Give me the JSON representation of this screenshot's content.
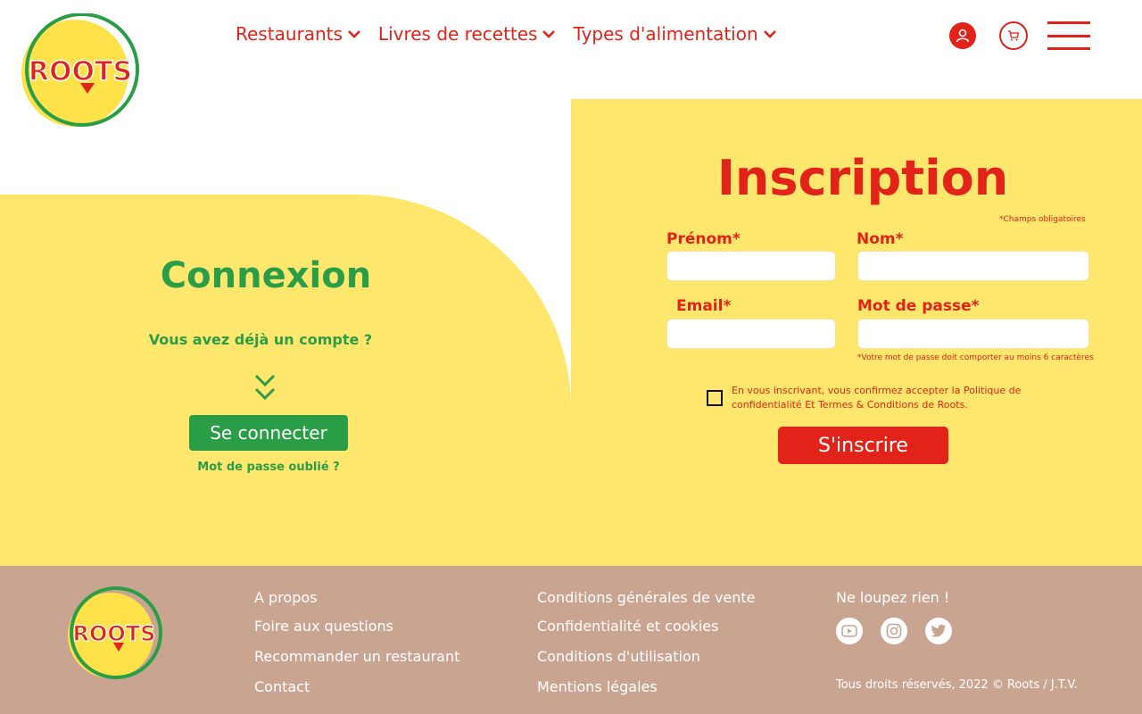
{
  "brand": {
    "name": "ROOTS",
    "colors": {
      "red": "#e2231a",
      "yellow": "#ffe66d",
      "green": "#2a9d47",
      "footer": "#c9a591"
    }
  },
  "header": {
    "nav": [
      {
        "label": "Restaurants",
        "icon": "chevron-down-icon"
      },
      {
        "label": "Livres de recettes",
        "icon": "chevron-down-icon"
      },
      {
        "label": "Types d'alimentation",
        "icon": "chevron-down-icon"
      }
    ],
    "icons": [
      "user-icon",
      "cart-icon",
      "menu-icon"
    ]
  },
  "login": {
    "title": "Connexion",
    "question": "Vous avez déjà un compte ?",
    "button": "Se connecter",
    "forgot": "Mot de passe oublié ?"
  },
  "signup": {
    "title": "Inscription",
    "required_note": "*Champs obligatoires",
    "fields": {
      "firstname": {
        "label": "Prénom*",
        "value": ""
      },
      "lastname": {
        "label": "Nom*",
        "value": ""
      },
      "email": {
        "label": "Email*",
        "value": ""
      },
      "password": {
        "label": "Mot de passe*",
        "value": ""
      }
    },
    "password_note": "*Votre mot de passe doit comporter au moins 6 caractères",
    "terms": "En vous inscrivant, vous confirmez accepter la Politique de confidentialité Et Termes & Conditions de Roots.",
    "terms_checked": false,
    "button": "S'inscrire"
  },
  "footer": {
    "col1": [
      "A propos",
      "Foire aux questions",
      "Recommander un restaurant",
      "Contact"
    ],
    "col2": [
      "Conditions générales de vente",
      "Confidentialité et cookies",
      "Conditions d'utilisation",
      "Mentions légales"
    ],
    "newsletter_title": "Ne loupez rien !",
    "social": [
      "youtube-icon",
      "instagram-icon",
      "twitter-icon"
    ],
    "copyright": "Tous droits réservés, 2022 © Roots / J.T.V."
  }
}
